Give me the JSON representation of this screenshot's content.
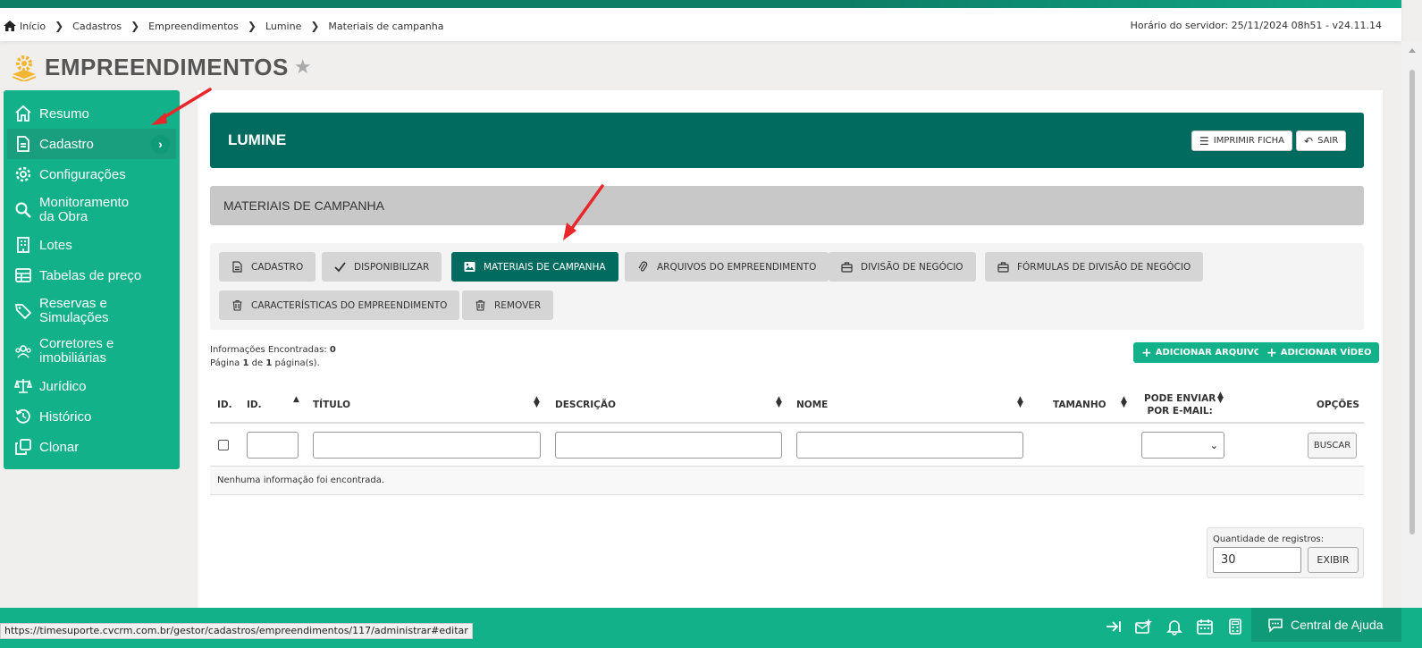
{
  "breadcrumb": {
    "items": [
      "Início",
      "Cadastros",
      "Empreendimentos",
      "Lumine",
      "Materiais de campanha"
    ]
  },
  "server_time": "Horário do servidor: 25/11/2024 08h51 - v24.11.14",
  "page": {
    "title": "EMPREENDIMENTOS"
  },
  "sidebar": {
    "items": [
      {
        "label": "Resumo",
        "icon": "home-icon"
      },
      {
        "label": "Cadastro",
        "icon": "document-icon"
      },
      {
        "label": "Configurações",
        "icon": "gear-icon"
      },
      {
        "label": "Monitoramento da Obra",
        "icon": "search-icon"
      },
      {
        "label": "Lotes",
        "icon": "building-icon"
      },
      {
        "label": "Tabelas de preço",
        "icon": "table-icon"
      },
      {
        "label": "Reservas e Simulações",
        "icon": "tag-icon"
      },
      {
        "label": "Corretores e imobiliárias",
        "icon": "users-icon"
      },
      {
        "label": "Jurídico",
        "icon": "scale-icon"
      },
      {
        "label": "Histórico",
        "icon": "history-icon"
      },
      {
        "label": "Clonar",
        "icon": "clone-icon"
      }
    ]
  },
  "header": {
    "title": "LUMINE",
    "print_label": "IMPRIMIR FICHA",
    "exit_label": "SAIR"
  },
  "section_title": "MATERIAIS DE CAMPANHA",
  "tabs": [
    {
      "label": "CADASTRO",
      "icon": "document-icon"
    },
    {
      "label": "DISPONIBILIZAR",
      "icon": "check-icon"
    },
    {
      "label": "MATERIAIS DE CAMPANHA",
      "icon": "image-icon"
    },
    {
      "label": "ARQUIVOS DO EMPREENDIMENTO",
      "icon": "paperclip-icon"
    },
    {
      "label": "DIVISÃO DE NEGÓCIO",
      "icon": "briefcase-icon"
    },
    {
      "label": "FÓRMULAS DE DIVISÃO DE NEGÓCIO",
      "icon": "briefcase-icon"
    },
    {
      "label": "CARACTERÍSTICAS DO EMPREENDIMENTO",
      "icon": "trash-icon"
    },
    {
      "label": "REMOVER",
      "icon": "trash-icon"
    }
  ],
  "info": {
    "found_label": "Informações Encontradas:",
    "found_count": "0",
    "page_prefix": "Página",
    "page_current": "1",
    "page_of": "de",
    "page_total": "1",
    "page_suffix": "página(s)."
  },
  "actions": {
    "add_file": "ADICIONAR ARQUIVO",
    "add_video": "ADICIONAR VÍDEO"
  },
  "table": {
    "columns": [
      "ID.",
      "ID.",
      "TÍTULO",
      "DESCRIÇÃO",
      "NOME",
      "TAMANHO",
      "PODE ENVIAR",
      "POR E-MAIL:",
      "OPÇÕES"
    ],
    "search_label": "BUSCAR",
    "empty_message": "Nenhuma informação foi encontrada."
  },
  "records": {
    "label": "Quantidade de registros:",
    "value": "30",
    "button": "EXIBIR"
  },
  "footer": {
    "help_label": "Central de Ajuda",
    "status_url": "https://timesuporte.cvcrm.com.br/gestor/cadastros/empreendimentos/117/administrar#editar"
  },
  "colors": {
    "primary_green": "#12b18a",
    "dark_green": "#006b5e",
    "annotation_red": "#e8272a"
  }
}
